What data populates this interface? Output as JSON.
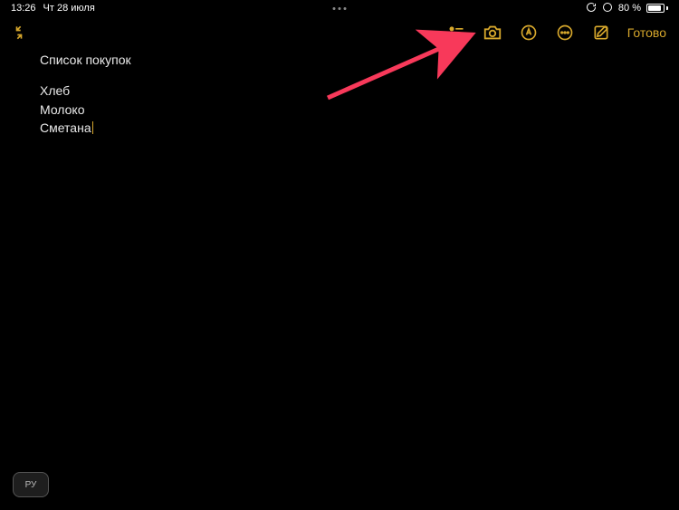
{
  "status": {
    "time": "13:26",
    "date": "Чт 28 июля",
    "battery_percent": "80 %"
  },
  "toolbar": {
    "done_label": "Готово"
  },
  "note": {
    "title": "Список покупок",
    "lines": [
      "Хлеб",
      "Молоко",
      "Сметана"
    ]
  },
  "keyboard": {
    "lang": "РУ"
  },
  "colors": {
    "accent": "#d6a72c",
    "arrow": "#f8395a"
  }
}
